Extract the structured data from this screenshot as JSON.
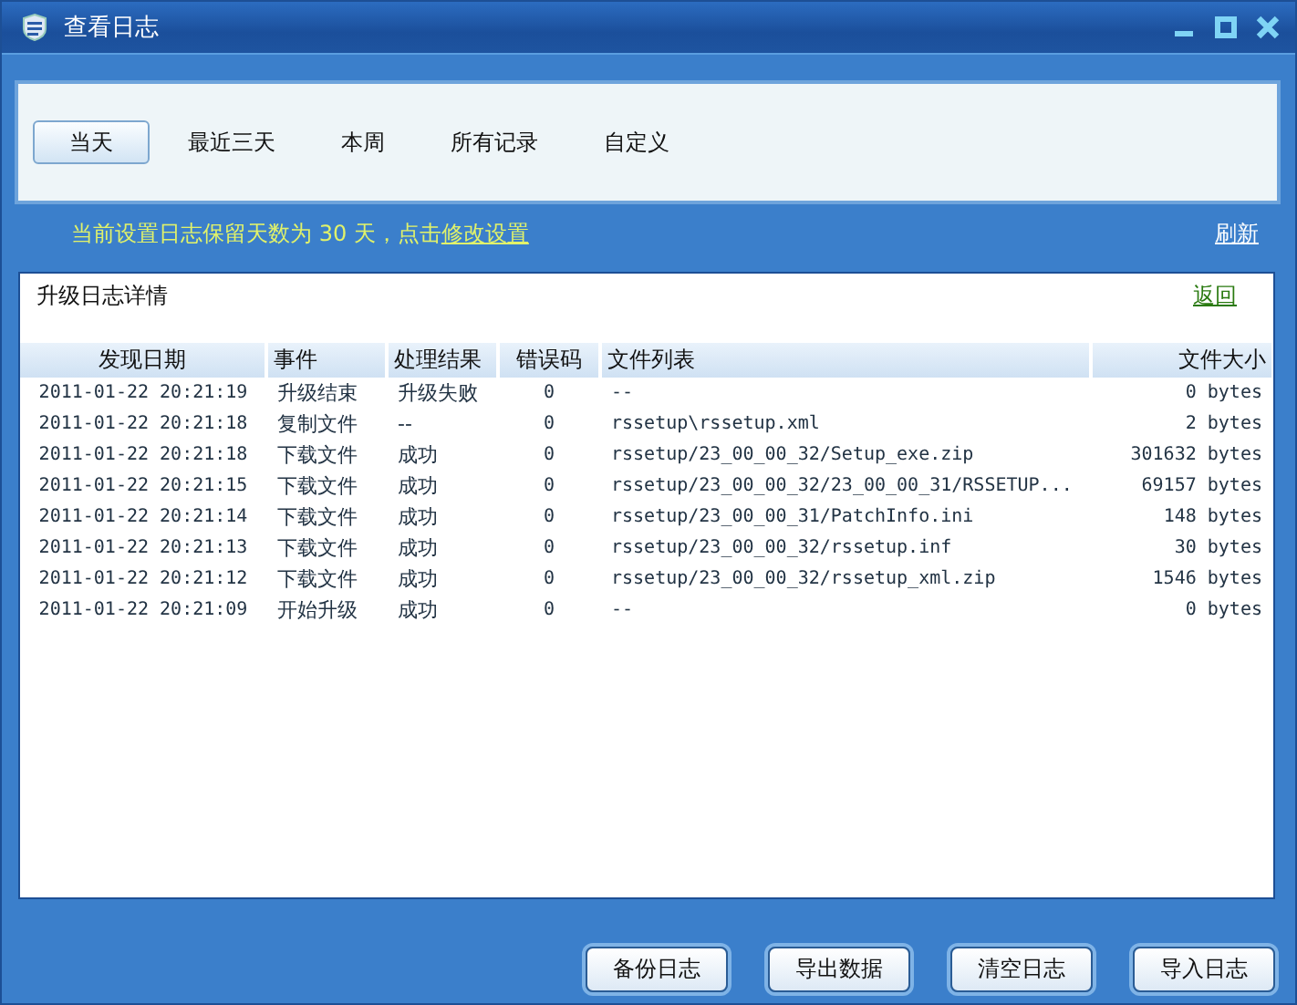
{
  "window": {
    "title": "查看日志"
  },
  "tabs": [
    {
      "label": "当天",
      "selected": true
    },
    {
      "label": "最近三天",
      "selected": false
    },
    {
      "label": "本周",
      "selected": false
    },
    {
      "label": "所有记录",
      "selected": false
    },
    {
      "label": "自定义",
      "selected": false
    }
  ],
  "notice": {
    "text": "当前设置日志保留天数为 30 天，点击",
    "link": "修改设置"
  },
  "refresh_link": "刷新",
  "panel": {
    "title": "升级日志详情",
    "back_link": "返回"
  },
  "table": {
    "columns": [
      "发现日期",
      "事件",
      "处理结果",
      "错误码",
      "文件列表",
      "文件大小"
    ],
    "rows": [
      [
        "2011-01-22 20:21:19",
        "升级结束",
        "升级失败",
        "0",
        "--",
        "0 bytes"
      ],
      [
        "2011-01-22 20:21:18",
        "复制文件",
        "--",
        "0",
        "rssetup\\rssetup.xml",
        "2 bytes"
      ],
      [
        "2011-01-22 20:21:18",
        "下载文件",
        "成功",
        "0",
        "rssetup/23_00_00_32/Setup_exe.zip",
        "301632 bytes"
      ],
      [
        "2011-01-22 20:21:15",
        "下载文件",
        "成功",
        "0",
        "rssetup/23_00_00_32/23_00_00_31/RSSETUP...",
        "69157 bytes"
      ],
      [
        "2011-01-22 20:21:14",
        "下载文件",
        "成功",
        "0",
        "rssetup/23_00_00_31/PatchInfo.ini",
        "148 bytes"
      ],
      [
        "2011-01-22 20:21:13",
        "下载文件",
        "成功",
        "0",
        "rssetup/23_00_00_32/rssetup.inf",
        "30 bytes"
      ],
      [
        "2011-01-22 20:21:12",
        "下载文件",
        "成功",
        "0",
        "rssetup/23_00_00_32/rssetup_xml.zip",
        "1546 bytes"
      ],
      [
        "2011-01-22 20:21:09",
        "开始升级",
        "成功",
        "0",
        "--",
        "0 bytes"
      ]
    ]
  },
  "buttons": [
    "备份日志",
    "导出数据",
    "清空日志",
    "导入日志"
  ]
}
